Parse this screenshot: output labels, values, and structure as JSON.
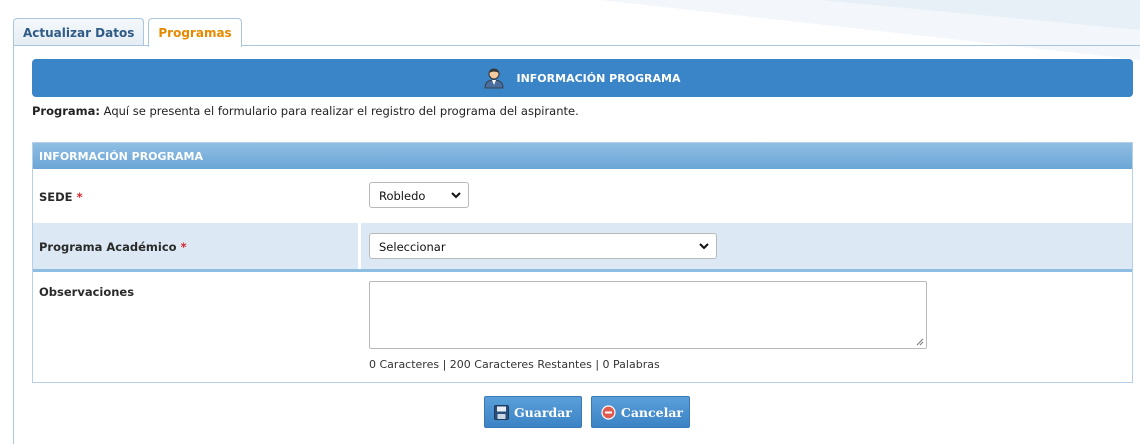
{
  "tabs": [
    {
      "label": "Actualizar Datos",
      "active": false
    },
    {
      "label": "Programas",
      "active": true
    }
  ],
  "header": {
    "title": "INFORMACIÓN PROGRAMA",
    "icon": "user-icon"
  },
  "intro": {
    "label": "Programa:",
    "text": " Aquí se presenta el formulario para realizar el registro del programa del aspirante."
  },
  "form": {
    "title": "INFORMACIÓN PROGRAMA",
    "required_mark": "*",
    "sede": {
      "label": "SEDE",
      "value": "Robledo"
    },
    "programa": {
      "label": "Programa Académico",
      "value": "Seleccionar"
    },
    "observaciones": {
      "label": "Observaciones",
      "value": "",
      "counter": "0 Caracteres | 200 Caracteres Restantes | 0 Palabras"
    }
  },
  "buttons": {
    "save": {
      "label": "Guardar",
      "icon": "floppy-disk-icon"
    },
    "cancel": {
      "label": "Cancelar",
      "icon": "minus-circle-icon"
    }
  },
  "colors": {
    "header_bg": "#3a84c8",
    "active_tab_text": "#e58a00",
    "required": "#d8252c",
    "button_bg": "#4a90d0"
  }
}
